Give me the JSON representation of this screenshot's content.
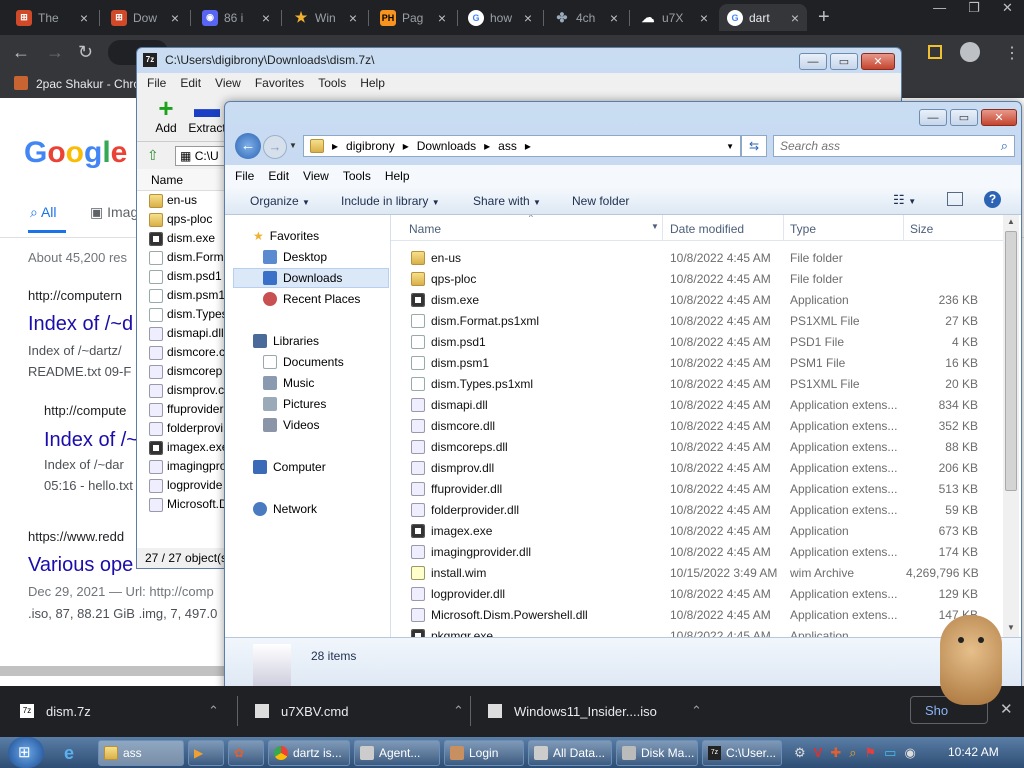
{
  "browser": {
    "tabs": [
      {
        "label": "The",
        "icon": "windows-icon",
        "active": false
      },
      {
        "label": "Dow",
        "icon": "windows-icon",
        "active": false
      },
      {
        "label": "86 i",
        "icon": "discord-icon",
        "active": false
      },
      {
        "label": "Win",
        "icon": "star-icon",
        "active": false
      },
      {
        "label": "Pag",
        "icon": "ph-icon",
        "active": false
      },
      {
        "label": "how",
        "icon": "google-icon",
        "active": false
      },
      {
        "label": "4ch",
        "icon": "clover-icon",
        "active": false
      },
      {
        "label": "u7X",
        "icon": "cloud-icon",
        "active": false
      },
      {
        "label": "dart",
        "icon": "google-icon",
        "active": true
      }
    ],
    "new_tab": "+",
    "bookmark": "2pac Shakur - Chro",
    "colors": {
      "dark": "#202124",
      "toolbar": "#35363a"
    }
  },
  "google": {
    "logo": "Google",
    "tab_all": "All",
    "tab_images": "Imag",
    "about": "About 45,200 res",
    "results": [
      {
        "url": "http://computern",
        "title": "Index of /~d",
        "snippet1": "Index of /~dartz/",
        "snippet2": "README.txt 09-F"
      },
      {
        "url": "http://compute",
        "title": "Index of /~",
        "snippet1": "Index of /~dar",
        "snippet2": "05:16 - hello.txt"
      },
      {
        "url": "https://www.redd",
        "title": "Various ope",
        "snippet1": "Dec 29, 2021 — Url: http://comp",
        "snippet2": ".iso, 87, 88.21 GiB .img, 7, 497.0"
      }
    ]
  },
  "sevenzip": {
    "title": "C:\\Users\\digibrony\\Downloads\\dism.7z\\",
    "menu": [
      "File",
      "Edit",
      "View",
      "Favorites",
      "Tools",
      "Help"
    ],
    "toolbar": {
      "add": "Add",
      "extract": "Extract"
    },
    "path": "C:\\U",
    "column": "Name",
    "files": [
      {
        "name": "en-us",
        "icon": "folder"
      },
      {
        "name": "qps-ploc",
        "icon": "folder"
      },
      {
        "name": "dism.exe",
        "icon": "app"
      },
      {
        "name": "dism.Form",
        "icon": "file"
      },
      {
        "name": "dism.psd1",
        "icon": "file"
      },
      {
        "name": "dism.psm1",
        "icon": "file"
      },
      {
        "name": "dism.Types",
        "icon": "file"
      },
      {
        "name": "dismapi.dll",
        "icon": "dll"
      },
      {
        "name": "dismcore.c",
        "icon": "dll"
      },
      {
        "name": "dismcorep",
        "icon": "dll"
      },
      {
        "name": "dismprov.c",
        "icon": "dll"
      },
      {
        "name": "ffuprovider",
        "icon": "dll"
      },
      {
        "name": "folderprovi",
        "icon": "dll"
      },
      {
        "name": "imagex.exe",
        "icon": "app"
      },
      {
        "name": "imagingprov",
        "icon": "dll"
      },
      {
        "name": "logprovide",
        "icon": "dll"
      },
      {
        "name": "Microsoft.D",
        "icon": "dll"
      }
    ],
    "status": "27 / 27 object(s"
  },
  "explorer": {
    "breadcrumb": [
      "digibrony",
      "Downloads",
      "ass"
    ],
    "search_placeholder": "Search ass",
    "menu": [
      "File",
      "Edit",
      "View",
      "Tools",
      "Help"
    ],
    "commands": {
      "organize": "Organize",
      "include": "Include in library",
      "share": "Share with",
      "new_folder": "New folder"
    },
    "nav": {
      "favorites": "Favorites",
      "desktop": "Desktop",
      "downloads": "Downloads",
      "recent": "Recent Places",
      "libraries": "Libraries",
      "documents": "Documents",
      "music": "Music",
      "pictures": "Pictures",
      "videos": "Videos",
      "computer": "Computer",
      "network": "Network"
    },
    "columns": {
      "name": "Name",
      "date": "Date modified",
      "type": "Type",
      "size": "Size"
    },
    "files": [
      {
        "name": "en-us",
        "date": "10/8/2022 4:45 AM",
        "type": "File folder",
        "size": "",
        "icon": "folder"
      },
      {
        "name": "qps-ploc",
        "date": "10/8/2022 4:45 AM",
        "type": "File folder",
        "size": "",
        "icon": "folder"
      },
      {
        "name": "dism.exe",
        "date": "10/8/2022 4:45 AM",
        "type": "Application",
        "size": "236 KB",
        "icon": "app"
      },
      {
        "name": "dism.Format.ps1xml",
        "date": "10/8/2022 4:45 AM",
        "type": "PS1XML File",
        "size": "27 KB",
        "icon": "file"
      },
      {
        "name": "dism.psd1",
        "date": "10/8/2022 4:45 AM",
        "type": "PSD1 File",
        "size": "4 KB",
        "icon": "file"
      },
      {
        "name": "dism.psm1",
        "date": "10/8/2022 4:45 AM",
        "type": "PSM1 File",
        "size": "16 KB",
        "icon": "file"
      },
      {
        "name": "dism.Types.ps1xml",
        "date": "10/8/2022 4:45 AM",
        "type": "PS1XML File",
        "size": "20 KB",
        "icon": "file"
      },
      {
        "name": "dismapi.dll",
        "date": "10/8/2022 4:45 AM",
        "type": "Application extens...",
        "size": "834 KB",
        "icon": "dll"
      },
      {
        "name": "dismcore.dll",
        "date": "10/8/2022 4:45 AM",
        "type": "Application extens...",
        "size": "352 KB",
        "icon": "dll"
      },
      {
        "name": "dismcoreps.dll",
        "date": "10/8/2022 4:45 AM",
        "type": "Application extens...",
        "size": "88 KB",
        "icon": "dll"
      },
      {
        "name": "dismprov.dll",
        "date": "10/8/2022 4:45 AM",
        "type": "Application extens...",
        "size": "206 KB",
        "icon": "dll"
      },
      {
        "name": "ffuprovider.dll",
        "date": "10/8/2022 4:45 AM",
        "type": "Application extens...",
        "size": "513 KB",
        "icon": "dll"
      },
      {
        "name": "folderprovider.dll",
        "date": "10/8/2022 4:45 AM",
        "type": "Application extens...",
        "size": "59 KB",
        "icon": "dll"
      },
      {
        "name": "imagex.exe",
        "date": "10/8/2022 4:45 AM",
        "type": "Application",
        "size": "673 KB",
        "icon": "app"
      },
      {
        "name": "imagingprovider.dll",
        "date": "10/8/2022 4:45 AM",
        "type": "Application extens...",
        "size": "174 KB",
        "icon": "dll"
      },
      {
        "name": "install.wim",
        "date": "10/15/2022 3:49 AM",
        "type": "wim Archive",
        "size": "4,269,796 KB",
        "icon": "wim"
      },
      {
        "name": "logprovider.dll",
        "date": "10/8/2022 4:45 AM",
        "type": "Application extens...",
        "size": "129 KB",
        "icon": "dll"
      },
      {
        "name": "Microsoft.Dism.Powershell.dll",
        "date": "10/8/2022 4:45 AM",
        "type": "Application extens...",
        "size": "147 KB",
        "icon": "dll"
      },
      {
        "name": "pkgmgr.exe",
        "date": "10/8/2022 4:45 AM",
        "type": "Application",
        "size": "",
        "icon": "app"
      }
    ],
    "details": "28 items"
  },
  "downloads": [
    {
      "name": "dism.7z"
    },
    {
      "name": "u7XBV.cmd"
    },
    {
      "name": "Windows11_Insider....iso"
    }
  ],
  "downloads_show": "Sho",
  "taskbar": {
    "items": [
      "ass",
      "",
      "",
      "dartz is...",
      "Agent...",
      "Login",
      "All Data...",
      "Disk Ma...",
      "C:\\User..."
    ],
    "clock": "10:42 AM"
  }
}
